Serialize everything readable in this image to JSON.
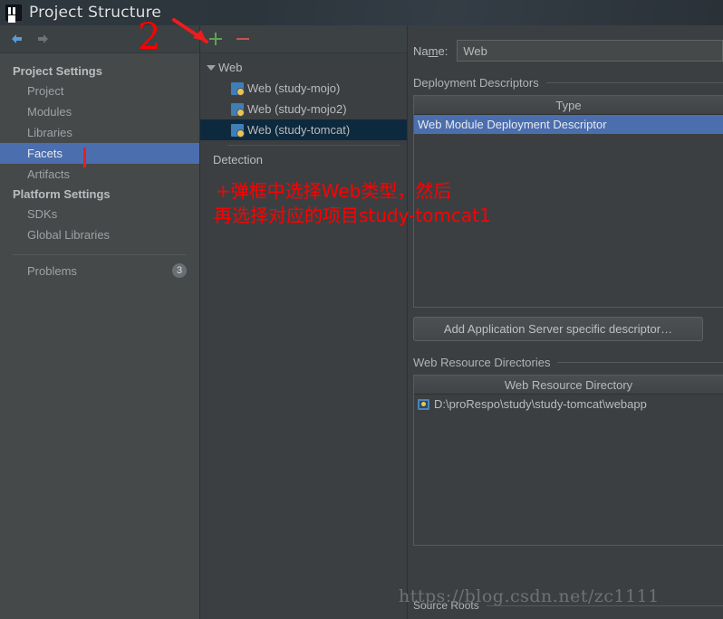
{
  "window": {
    "title": "Project Structure",
    "logo_icon": "intellij-idea-logo-icon"
  },
  "toolbar": {
    "back_icon": "arrow-left-icon",
    "forward_icon": "arrow-right-icon"
  },
  "sidebar": {
    "groups": [
      {
        "label": "Project Settings",
        "items": [
          {
            "label": "Project",
            "selected": false
          },
          {
            "label": "Modules",
            "selected": false
          },
          {
            "label": "Libraries",
            "selected": false
          },
          {
            "label": "Facets",
            "selected": true
          },
          {
            "label": "Artifacts",
            "selected": false
          }
        ]
      },
      {
        "label": "Platform Settings",
        "items": [
          {
            "label": "SDKs",
            "selected": false
          },
          {
            "label": "Global Libraries",
            "selected": false
          }
        ]
      }
    ],
    "problems": {
      "label": "Problems",
      "count": "3"
    }
  },
  "tree_panel": {
    "toolbar": {
      "add_label": "+",
      "add_icon": "plus-icon",
      "remove_label": "−",
      "remove_icon": "minus-icon"
    },
    "nodes": [
      {
        "label": "Web",
        "type": "root",
        "expanded": true,
        "selected": false
      },
      {
        "label": "Web (study-mojo)",
        "type": "child",
        "icon": "web-facet-icon",
        "selected": false
      },
      {
        "label": "Web (study-mojo2)",
        "type": "child",
        "icon": "web-facet-icon",
        "selected": false
      },
      {
        "label": "Web (study-tomcat)",
        "type": "child",
        "icon": "web-facet-icon",
        "selected": true
      }
    ],
    "detection_label": "Detection"
  },
  "detail": {
    "name_label_pre": "Na",
    "name_label_mnemonic": "m",
    "name_label_post": "e:",
    "name_value": "Web",
    "deployment_descriptors": {
      "title": "Deployment Descriptors",
      "column_header": "Type",
      "rows": [
        {
          "label": "Web Module Deployment Descriptor",
          "selected": true
        }
      ],
      "add_button": "Add Application Server specific descriptor…"
    },
    "web_resource_directories": {
      "title": "Web Resource Directories",
      "column_header": "Web Resource Directory",
      "rows": [
        {
          "label": "D:\\proRespo\\study\\study-tomcat\\webapp",
          "icon": "folder-web-icon",
          "selected": false
        }
      ]
    },
    "source_roots_label": "Source Roots"
  },
  "annotations": {
    "step_number": "2",
    "arrow_icon": "red-arrow-icon",
    "tick_icon": "red-tick-marker",
    "note_line1": "+弹框中选择Web类型，然后",
    "note_line2": "再选择对应的项目study-tomcat1",
    "watermark": "https://blog.csdn.net/zc1111"
  },
  "colors": {
    "accent_selection": "#4b6eaf",
    "tree_selection": "#0d293e",
    "annotation_red": "#ff0000",
    "add_green": "#5aa455",
    "remove_red": "#c75450",
    "panel_bg": "#3c3f41",
    "sidebar_bg": "#45494a"
  }
}
